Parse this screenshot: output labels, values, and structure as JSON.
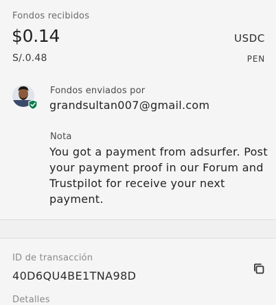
{
  "payment": {
    "received_label": "Fondos recibidos",
    "amount": "$0.14",
    "currency": "USDC",
    "local_amount": "S/.0.48",
    "local_currency": "PEN"
  },
  "sender": {
    "label": "Fondos enviados por",
    "email": "grandsultan007@gmail.com",
    "avatar_icon": "user-avatar-verified"
  },
  "note": {
    "label": "Nota",
    "text": "You got a payment from adsurfer. Post your payment proof in our Forum and Trustpilot for receive your next payment."
  },
  "transaction": {
    "id_label": "ID de transacción",
    "id_value": "40D6QU4BE1TNA98D",
    "copy_icon": "copy-icon",
    "next_label": "Detalles"
  },
  "colors": {
    "background": "#f5f5f5",
    "verified_badge": "#0a7d4b"
  }
}
